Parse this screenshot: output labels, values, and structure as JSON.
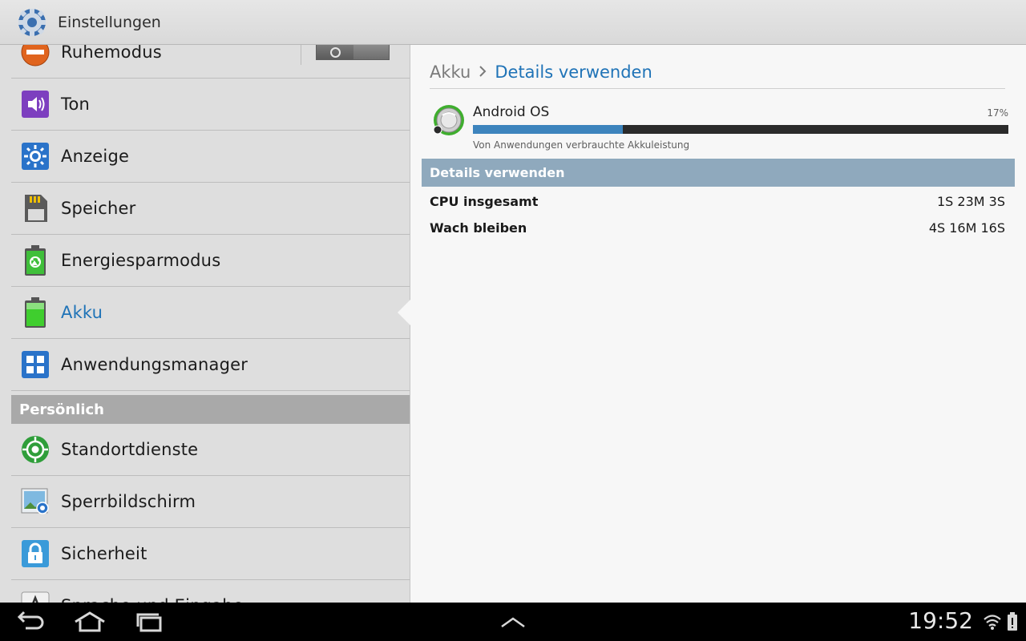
{
  "actionbar": {
    "title": "Einstellungen",
    "icon": "settings-gear-icon"
  },
  "sidebar": {
    "items": [
      {
        "id": "ruhemodus",
        "label": "Ruhemodus",
        "icon": "block-icon",
        "toggle": "off"
      },
      {
        "id": "ton",
        "label": "Ton",
        "icon": "volume-icon"
      },
      {
        "id": "anzeige",
        "label": "Anzeige",
        "icon": "brightness-icon"
      },
      {
        "id": "speicher",
        "label": "Speicher",
        "icon": "sd-card-icon"
      },
      {
        "id": "energiesparmodus",
        "label": "Energiesparmodus",
        "icon": "recycle-battery-icon"
      },
      {
        "id": "akku",
        "label": "Akku",
        "icon": "battery-icon",
        "selected": true
      },
      {
        "id": "anwendungsmanager",
        "label": "Anwendungsmanager",
        "icon": "grid-icon"
      }
    ],
    "section_persoenlich": "Persönlich",
    "items2": [
      {
        "id": "standortdienste",
        "label": "Standortdienste",
        "icon": "location-icon"
      },
      {
        "id": "sperrbildschirm",
        "label": "Sperrbildschirm",
        "icon": "lockscreen-icon"
      },
      {
        "id": "sicherheit",
        "label": "Sicherheit",
        "icon": "lock-icon"
      },
      {
        "id": "sprache",
        "label": "Sprache und Eingabe",
        "icon": "language-icon"
      }
    ]
  },
  "detail": {
    "breadcrumb_parent": "Akku",
    "breadcrumb_current": "Details verwenden",
    "app_name": "Android OS",
    "app_percent": "17%",
    "app_usage_fraction": 0.28,
    "app_subtitle": "Von Anwendungen verbrauchte Akkuleistung",
    "section_title": "Details verwenden",
    "rows": [
      {
        "key": "CPU insgesamt",
        "value": "1S 23M 3S"
      },
      {
        "key": "Wach bleiben",
        "value": "4S 16M 16S"
      }
    ]
  },
  "navbar": {
    "time": "19:52"
  },
  "colors": {
    "accent": "#1f73b7",
    "section_bg": "#a9a9a9",
    "detail_header_bg": "#8fa9bd",
    "bar_fill": "#3d84bd"
  }
}
